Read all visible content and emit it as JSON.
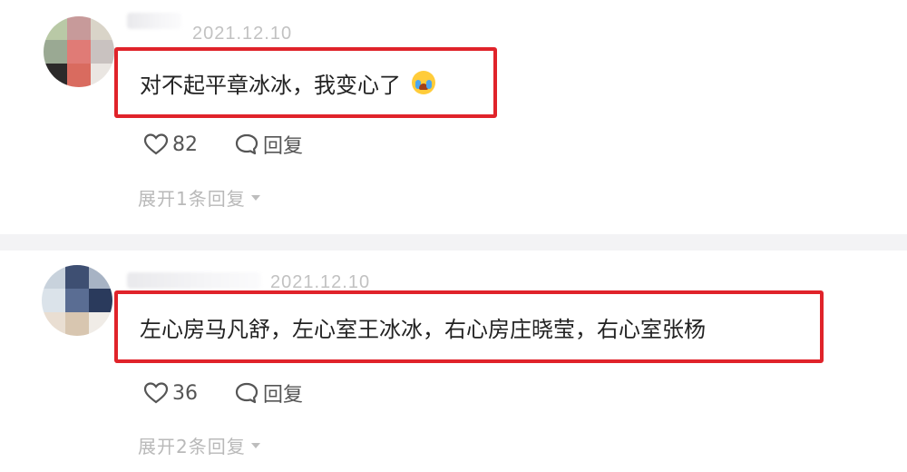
{
  "comments": [
    {
      "timestamp": "2021.12.10",
      "text": "对不起平章冰冰，我变心了",
      "emoji": "crying-face-emoji",
      "likes": "82",
      "reply_label": "回复",
      "expand_label": "展开1条回复"
    },
    {
      "timestamp": "2021.12.10",
      "text": "左心房马凡舒，左心室王冰冰，右心房庄晓莹，右心室张杨",
      "likes": "36",
      "reply_label": "回复",
      "expand_label": "展开2条回复"
    }
  ],
  "colors": {
    "highlight_border": "#e0232a",
    "meta_text": "#c2c2c2",
    "divider": "#f3f3f5"
  }
}
